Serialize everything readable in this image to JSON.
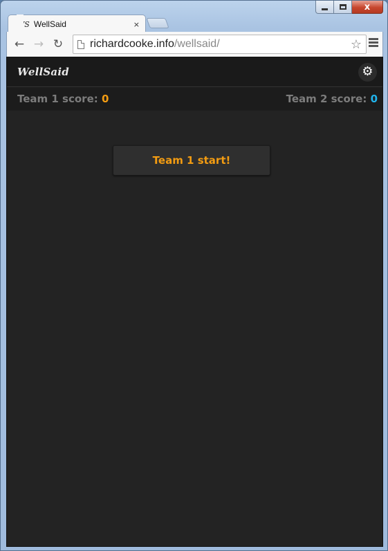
{
  "browser": {
    "tab": {
      "favicon_text": "WS",
      "title": "WellSaid",
      "close_glyph": "×"
    },
    "address": {
      "domain": "richardcooke.info",
      "path": "/wellsaid/"
    },
    "nav": {
      "back": "←",
      "forward": "→",
      "reload": "↻",
      "star": "☆"
    },
    "window_controls": {
      "close_glyph": "x"
    }
  },
  "app": {
    "brand": "WellSaid",
    "settings_icon_glyph": "⚙",
    "team1": {
      "label": "Team 1 score:",
      "score": "0"
    },
    "team2": {
      "label": "Team 2 score:",
      "score": "0"
    },
    "start_button": "Team 1 start!"
  },
  "colors": {
    "team1_accent": "#f39c12",
    "team2_accent": "#20b3ec",
    "page_background": "#232323"
  }
}
